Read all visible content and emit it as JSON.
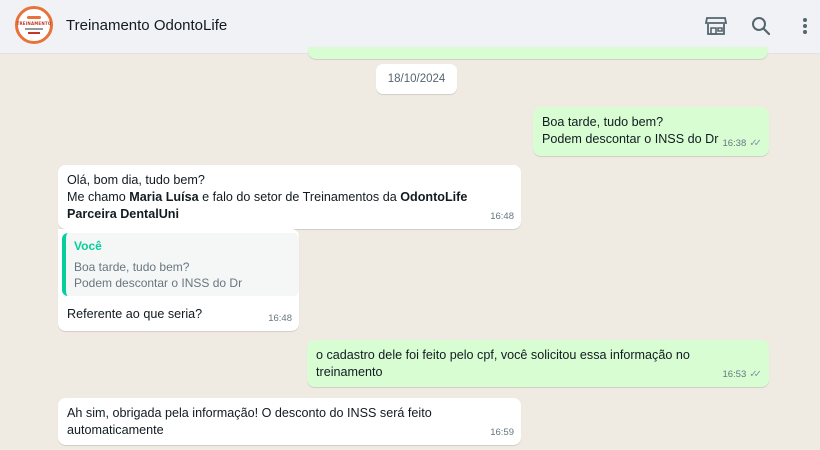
{
  "header": {
    "title": "Treinamento OdontoLife",
    "avatar_text": "TREINAMENTO",
    "icons": [
      "store-icon",
      "search-icon",
      "menu-icon"
    ]
  },
  "date_divider": "18/10/2024",
  "messages": [
    {
      "line1": "Boa tarde, tudo bem?",
      "line2": "Podem descontar o INSS do Dr",
      "time": "16:38"
    },
    {
      "line1": "Olá, bom dia, tudo bem?",
      "line2_a": "Me chamo ",
      "line2_b": "Maria Luísa",
      "line2_c": " e falo do setor de Treinamentos da ",
      "line2_d": "OdontoLife",
      "line3": "Parceira DentalUni",
      "time": "16:48"
    },
    {
      "quote_author": "Você",
      "quote_line1": "Boa tarde, tudo bem?",
      "quote_line2": "Podem descontar o INSS do Dr",
      "text": "Referente ao que seria?",
      "time": "16:48"
    },
    {
      "line1": "o cadastro dele foi feito pelo cpf, você solicitou essa informação no",
      "line2": "treinamento",
      "time": "16:53"
    },
    {
      "line1": "Ah sim, obrigada pela informação! O desconto do INSS será feito",
      "line2": "automaticamente",
      "time": "16:59"
    }
  ]
}
